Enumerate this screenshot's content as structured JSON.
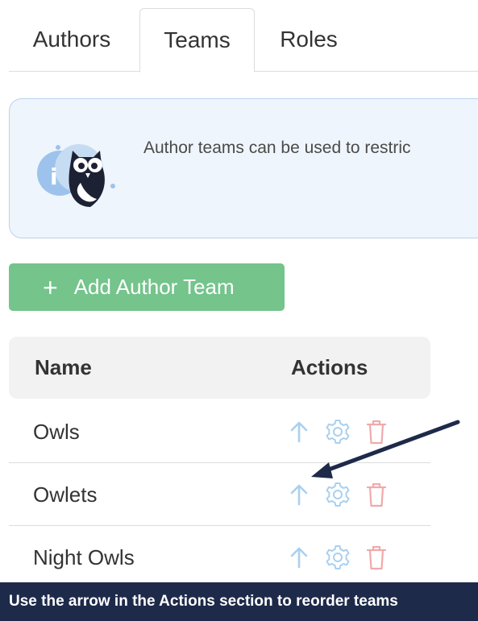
{
  "tabs": [
    {
      "label": "Authors",
      "active": false
    },
    {
      "label": "Teams",
      "active": true
    },
    {
      "label": "Roles",
      "active": false
    }
  ],
  "info": {
    "message": "Author teams can be used to restric"
  },
  "add_button": {
    "label": "Add Author Team"
  },
  "table": {
    "headers": {
      "name": "Name",
      "actions": "Actions"
    },
    "rows": [
      {
        "name": "Owls"
      },
      {
        "name": "Owlets"
      },
      {
        "name": "Night Owls"
      }
    ]
  },
  "icons": {
    "move_up": "arrow-up-icon",
    "settings": "gear-icon",
    "delete": "trash-icon",
    "add": "plus-icon",
    "mascot": "owl-info-icon"
  },
  "colors": {
    "accent_green": "#74c48b",
    "move_icon": "#a9d0f0",
    "gear_icon": "#a9d0f0",
    "trash_icon": "#f0aaaa",
    "caption_bg": "#1e2a4a",
    "arrow": "#1e2a4a"
  },
  "caption": {
    "text": "Use the arrow in the Actions section to reorder teams"
  }
}
